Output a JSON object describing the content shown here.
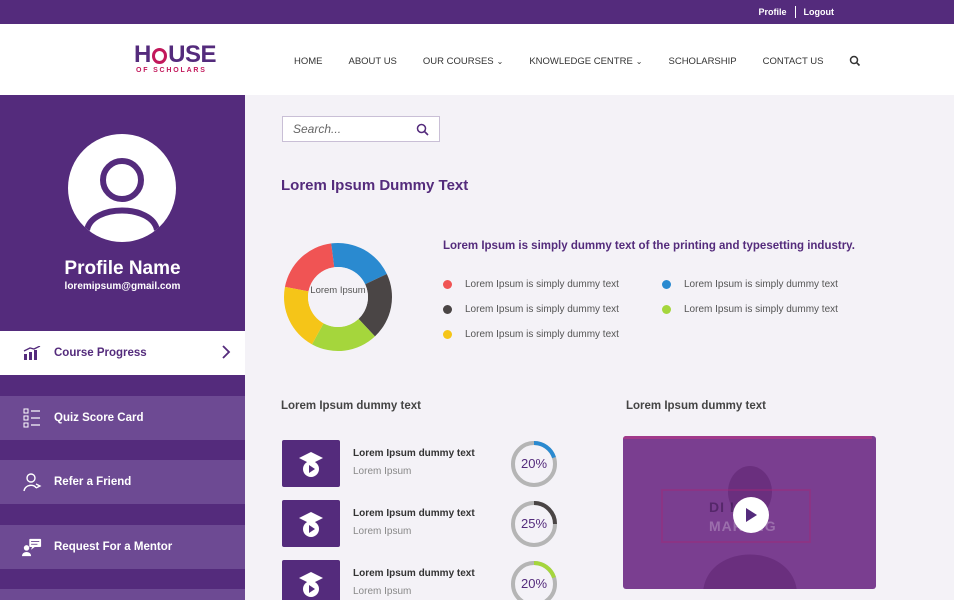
{
  "topbar": {
    "profile_label": "Profile",
    "logout_label": "Logout"
  },
  "logo": {
    "main_text": "HOUSE",
    "main_prefix": "H",
    "main_suffix": "USE",
    "sub_text": "OF SCHOLARS"
  },
  "nav": {
    "items": [
      {
        "label": "HOME",
        "has_dropdown": false
      },
      {
        "label": "ABOUT US",
        "has_dropdown": false
      },
      {
        "label": "OUR COURSES",
        "has_dropdown": true
      },
      {
        "label": "KNOWLEDGE CENTRE",
        "has_dropdown": true
      },
      {
        "label": "SCHOLARSHIP",
        "has_dropdown": false
      },
      {
        "label": "CONTACT US",
        "has_dropdown": false
      }
    ],
    "search_icon": "search-icon"
  },
  "sidebar": {
    "profile_name": "Profile Name",
    "email": "loremipsum@gmail.com",
    "menu": [
      {
        "label": "Course Progress",
        "icon": "bar-chart-icon",
        "active": true
      },
      {
        "label": "Quiz Score Card",
        "icon": "checklist-icon",
        "active": false
      },
      {
        "label": "Refer a Friend",
        "icon": "user-plus-icon",
        "active": false
      },
      {
        "label": "Request For a Mentor",
        "icon": "chat-user-icon",
        "active": false
      }
    ]
  },
  "search": {
    "placeholder": "Search..."
  },
  "main": {
    "title": "Lorem Ipsum Dummy Text",
    "chart_description": "Lorem Ipsum is simply dummy text of the printing and typesetting industry.",
    "donut_center_label": "Lorem Ipsum",
    "legend": [
      {
        "label": "Lorem Ipsum is simply dummy text",
        "color": "#f05454"
      },
      {
        "label": "Lorem Ipsum is simply dummy text",
        "color": "#2a8ad0"
      },
      {
        "label": "Lorem Ipsum is simply dummy text",
        "color": "#4a4545"
      },
      {
        "label": "Lorem Ipsum is simply dummy text",
        "color": "#a5d63c"
      },
      {
        "label": "Lorem Ipsum is simply dummy text",
        "color": "#f5c518"
      }
    ],
    "courses_section_title": "Lorem Ipsum dummy text",
    "video_section_title": "Lorem Ipsum dummy text",
    "courses": [
      {
        "title": "Lorem Ipsum dummy text",
        "subtitle": "Lorem Ipsum",
        "progress_label": "20%",
        "progress": 0.2,
        "ring_color": "#2a8ad0"
      },
      {
        "title": "Lorem Ipsum dummy text",
        "subtitle": "Lorem Ipsum",
        "progress_label": "25%",
        "progress": 0.25,
        "ring_color": "#4a4545"
      },
      {
        "title": "Lorem Ipsum dummy text",
        "subtitle": "Lorem Ipsum",
        "progress_label": "20%",
        "progress": 0.2,
        "ring_color": "#a5d63c"
      }
    ],
    "video": {
      "watermark_line1": "DI   L",
      "watermark_line2": "MAR   ING"
    }
  },
  "colors": {
    "brand": "#542b7c",
    "accent": "#c2185b",
    "menu_bg": "#6d4a93",
    "page_bg": "#f4f2f7"
  },
  "chart_data": {
    "type": "pie",
    "categories": [
      "red",
      "blue",
      "dark",
      "green",
      "yellow"
    ],
    "values": [
      20,
      20,
      20,
      20,
      20
    ]
  }
}
